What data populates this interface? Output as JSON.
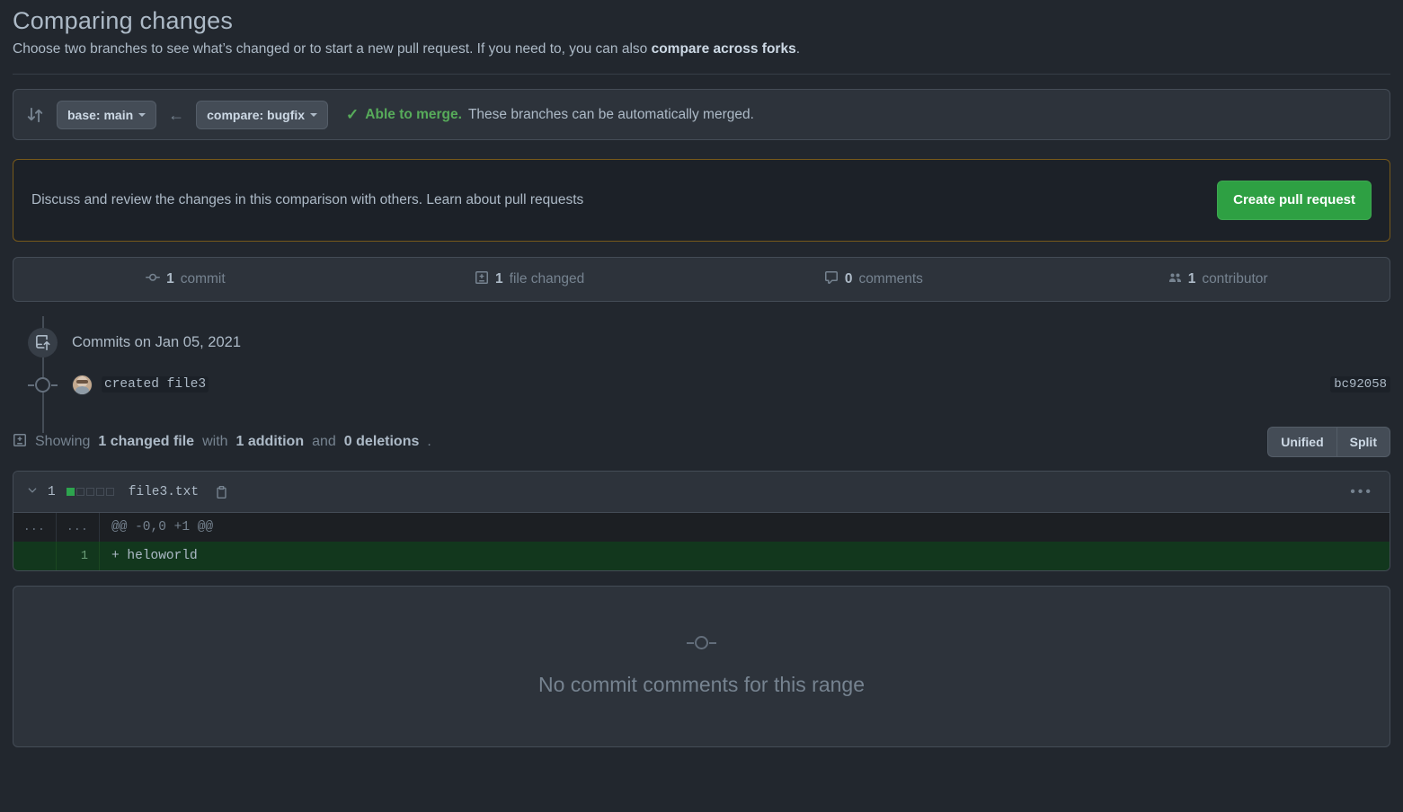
{
  "header": {
    "title": "Comparing changes",
    "subtitle_pre": "Choose two branches to see what’s changed or to start a new pull request. If you need to, you can also ",
    "subtitle_link": "compare across forks",
    "subtitle_post": "."
  },
  "branch_bar": {
    "compare_icon": "compare-branches-icon",
    "base_label": "base: main",
    "arrow": "←",
    "compare_label": "compare: bugfix",
    "check_glyph": "✓",
    "merge_status_strong": "Able to merge.",
    "merge_status_rest": " These branches can be automatically merged."
  },
  "pr_banner": {
    "text": "Discuss and review the changes in this comparison with others. Learn about pull requests",
    "button_label": "Create pull request",
    "button_color": "#2ea043",
    "border_color": "#77591a"
  },
  "stats": [
    {
      "icon": "commit-icon",
      "count": "1",
      "label": " commit"
    },
    {
      "icon": "file-diff-icon",
      "count": "1",
      "label": " file changed"
    },
    {
      "icon": "comment-icon",
      "count": "0",
      "label": " comments"
    },
    {
      "icon": "people-icon",
      "count": "1",
      "label": " contributor"
    }
  ],
  "timeline": {
    "badge_icon": "repo-push-icon",
    "heading": "Commits on Jan 05, 2021",
    "commit": {
      "avatar": "user-avatar",
      "message": "created file3",
      "sha": "bc92058"
    }
  },
  "showing": {
    "icon": "file-diff-icon",
    "pre": "Showing ",
    "files": "1 changed file",
    "mid": " with ",
    "additions": "1 addition",
    "and": " and ",
    "deletions": "0 deletions",
    "end": ".",
    "unified_label": "Unified",
    "split_label": "Split"
  },
  "diff": {
    "chevron": "⌄",
    "stat_count": "1",
    "blocks_on": 1,
    "blocks_off": 4,
    "filename": "file3.txt",
    "copy_icon": "copy-icon",
    "kebab": "•••",
    "rows": [
      {
        "type": "hunk",
        "old_ln": "...",
        "new_ln": "...",
        "code": "@@ -0,0 +1 @@"
      },
      {
        "type": "add",
        "old_ln": "",
        "new_ln": "1",
        "code": "+ heloworld"
      }
    ]
  },
  "no_comments": {
    "icon": "commit-dot-icon",
    "text": "No commit comments for this range"
  }
}
